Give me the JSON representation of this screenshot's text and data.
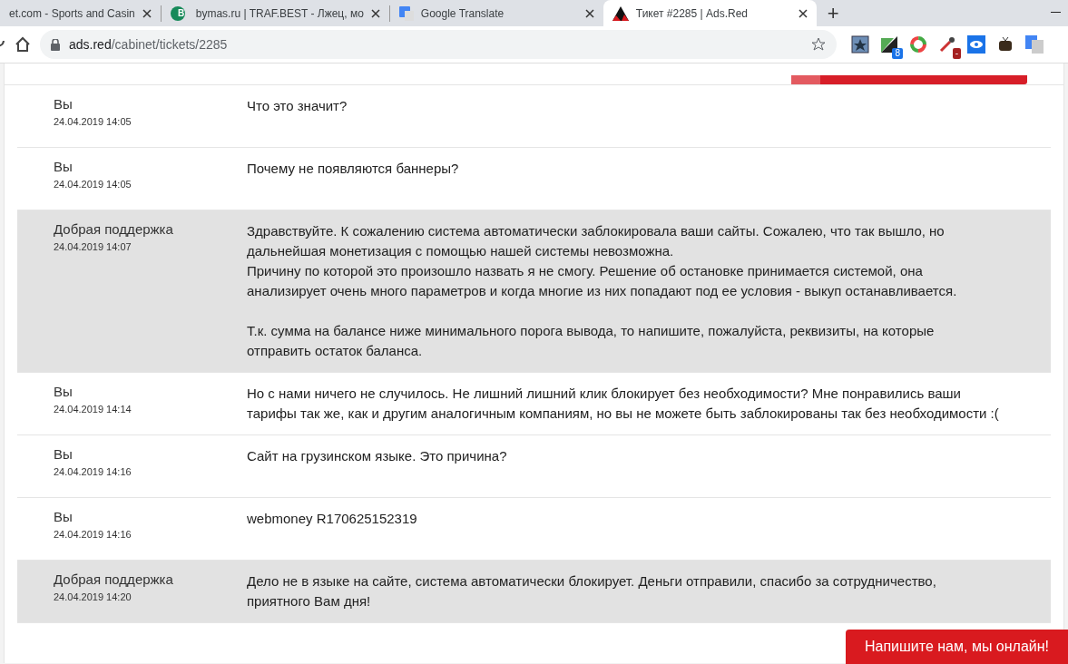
{
  "browser": {
    "tabs": [
      {
        "title": "et.com - Sports and Casin",
        "kind": "plain",
        "selected": false
      },
      {
        "title": "bymas.ru | TRAF.BEST - Лжец, мо",
        "kind": "letter",
        "icon_text": "B",
        "selected": false
      },
      {
        "title": "Google Translate",
        "kind": "translate",
        "selected": false
      },
      {
        "title": "Тикет #2285 | Ads.Red",
        "kind": "logo",
        "selected": true
      }
    ],
    "new_tab": "+",
    "url": {
      "host": "ads.red",
      "path": "/cabinet/tickets/2285"
    },
    "extensions": [
      {
        "kind": "star"
      },
      {
        "kind": "chart",
        "badge": "8"
      },
      {
        "kind": "ring"
      },
      {
        "kind": "dropper",
        "badge": "-"
      },
      {
        "kind": "eye"
      },
      {
        "kind": "tv"
      },
      {
        "kind": "translate"
      }
    ]
  },
  "ticket": {
    "messages": [
      {
        "kind": "user",
        "author": "Вы",
        "date": "24.04.2019 14:05",
        "paragraphs": [
          [
            "Что это значит?"
          ]
        ]
      },
      {
        "kind": "user",
        "author": "Вы",
        "date": "24.04.2019 14:05",
        "paragraphs": [
          [
            "Почему не появляются баннеры?"
          ]
        ]
      },
      {
        "kind": "support",
        "author": "Добрая поддержка",
        "date": "24.04.2019 14:07",
        "paragraphs": [
          [
            "Здравствуйте. К сожалению система автоматически заблокировала ваши сайты. Сожалею, что так вышло, но дальнейшая монетизация с помощью нашей системы невозможна.",
            "Причину по которой это произошло назвать я не смогу. Решение об остановке принимается системой, она анализирует очень много параметров и когда многие из них попадают под ее условия - выкуп останавливается."
          ],
          [
            "Т.к. сумма на балансе ниже минимального порога вывода, то напишите, пожалуйста, реквизиты, на которые отправить остаток баланса."
          ]
        ]
      },
      {
        "kind": "user",
        "author": "Вы",
        "date": "24.04.2019 14:14",
        "paragraphs": [
          [
            "Но с нами ничего не случилось. Не лишний лишний клик блокирует без необходимости? Мне понравились ваши тарифы так же, как и другим аналогичным компаниям, но вы не можете быть заблокированы так без необходимости :("
          ]
        ]
      },
      {
        "kind": "user",
        "author": "Вы",
        "date": "24.04.2019 14:16",
        "paragraphs": [
          [
            "Сайт на грузинском языке. Это причина?"
          ]
        ]
      },
      {
        "kind": "user",
        "author": "Вы",
        "date": "24.04.2019 14:16",
        "paragraphs": [
          [
            "webmoney R170625152319"
          ]
        ]
      },
      {
        "kind": "support",
        "author": "Добрая поддержка",
        "date": "24.04.2019 14:20",
        "paragraphs": [
          [
            "Дело не в языке на сайте, система автоматически блокирует. Деньги отправили, спасибо за сотрудничество, приятного Вам дня!"
          ]
        ]
      }
    ]
  },
  "chat_button": "Напишите нам, мы онлайн!"
}
